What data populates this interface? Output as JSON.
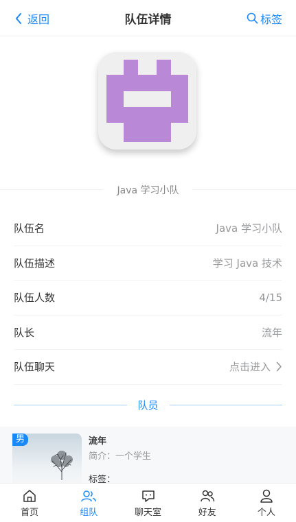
{
  "nav": {
    "back_label": "返回",
    "title": "队伍详情",
    "right_label": "标签"
  },
  "team": {
    "caption": "Java 学习小队",
    "avatar_color": "#b988d6"
  },
  "cells": [
    {
      "label": "队伍名",
      "value": "Java 学习小队"
    },
    {
      "label": "队伍描述",
      "value": "学习 Java 技术"
    },
    {
      "label": "队伍人数",
      "value": "4/15"
    },
    {
      "label": "队长",
      "value": "流年"
    },
    {
      "label": "队伍聊天",
      "value": "点击进入"
    }
  ],
  "members_divider": "队员",
  "member": {
    "gender": "男",
    "name": "流年",
    "intro": "简介：一个学生",
    "tags": "标签："
  },
  "tabbar": [
    {
      "label": "首页",
      "icon": "home-icon"
    },
    {
      "label": "组队",
      "icon": "team-icon"
    },
    {
      "label": "聊天室",
      "icon": "chat-icon"
    },
    {
      "label": "好友",
      "icon": "friends-icon"
    },
    {
      "label": "个人",
      "icon": "user-icon"
    }
  ],
  "colors": {
    "accent": "#1989fa",
    "text": "#323233",
    "muted": "#969799"
  }
}
